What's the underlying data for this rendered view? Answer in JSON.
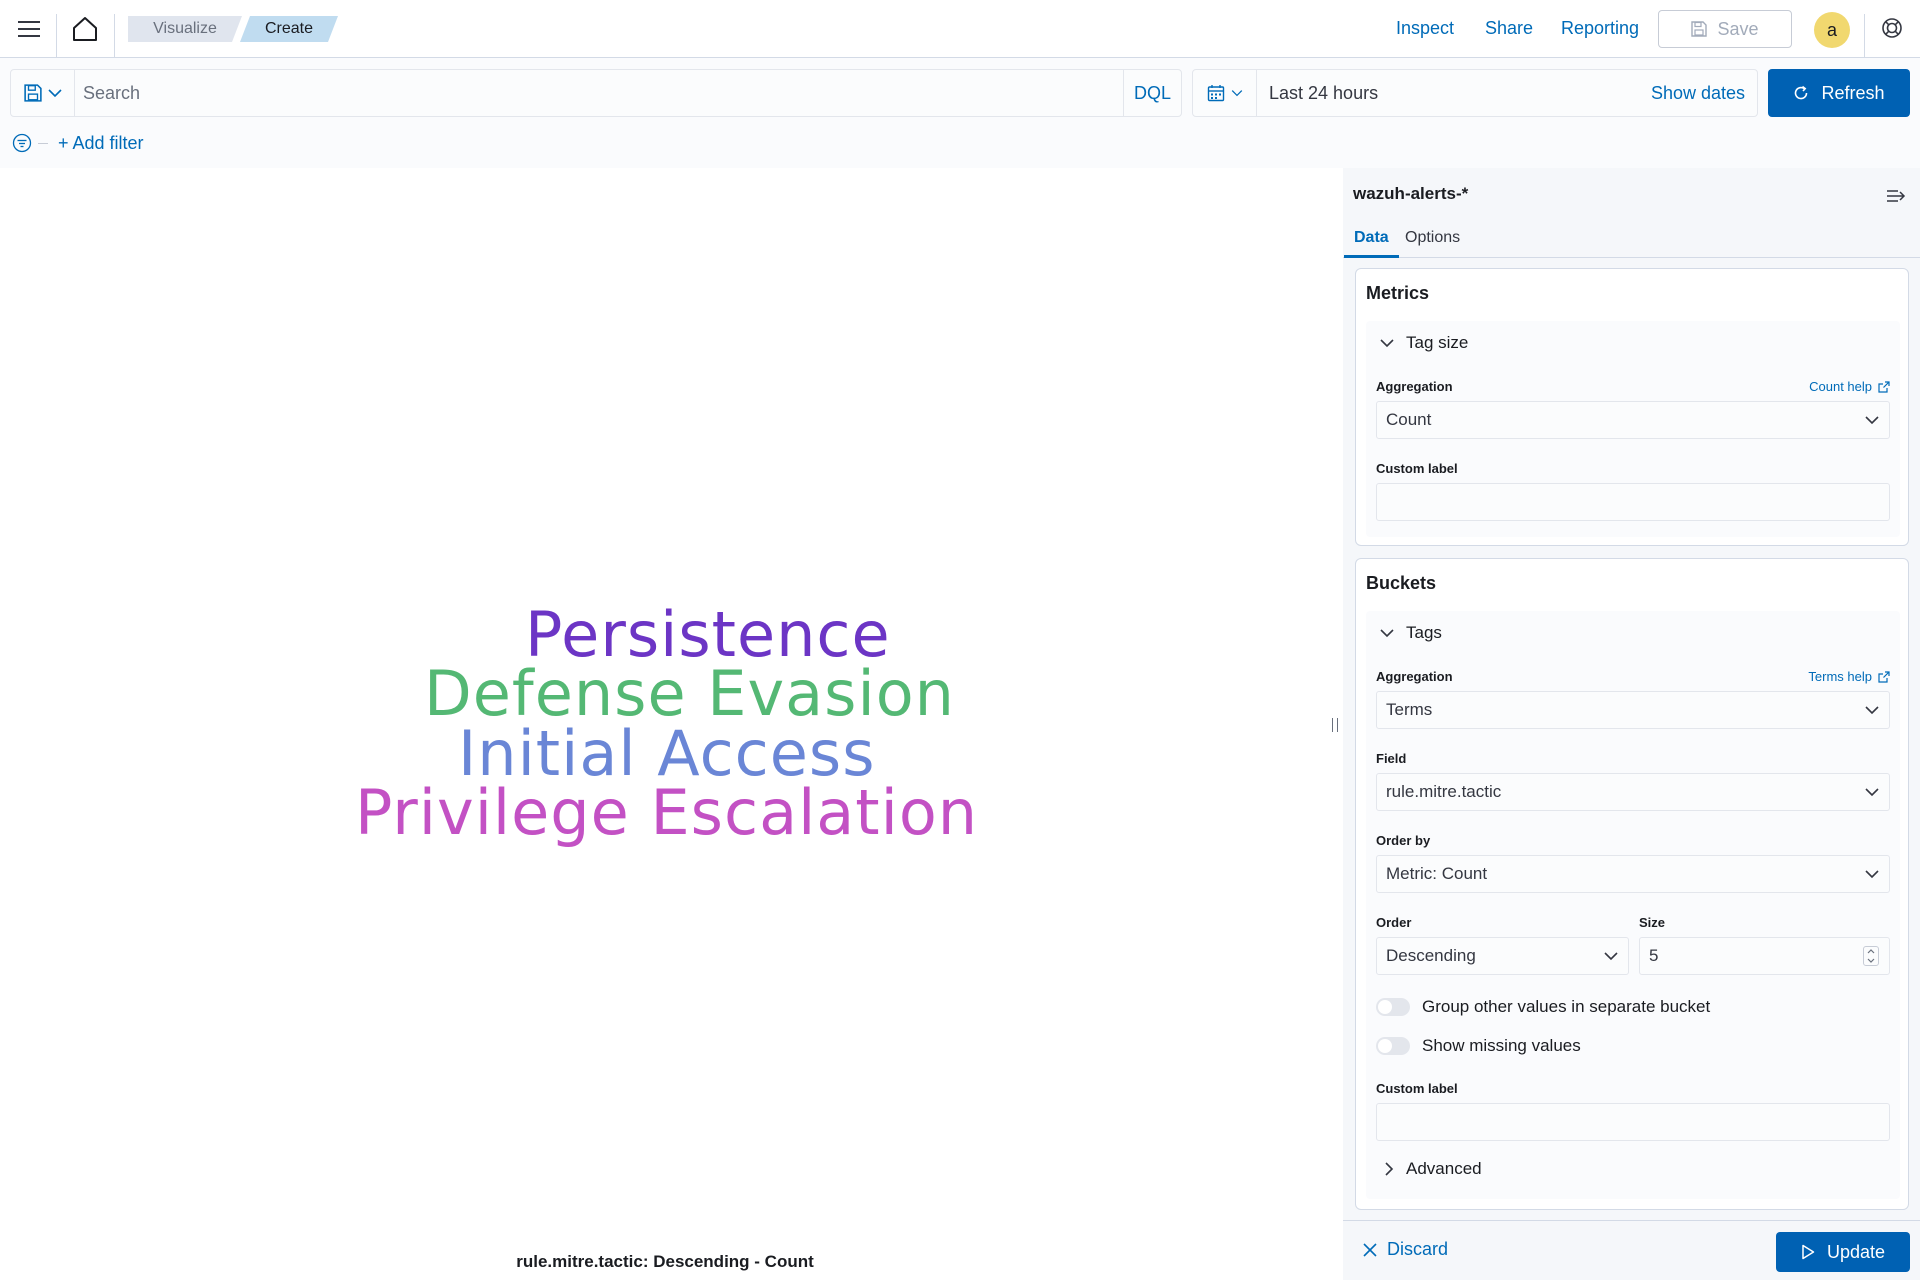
{
  "header": {
    "breadcrumbs": [
      "Visualize",
      "Create"
    ],
    "links": [
      "Inspect",
      "Share",
      "Reporting"
    ],
    "save_label": "Save",
    "avatar_initial": "a"
  },
  "query_bar": {
    "search_placeholder": "Search",
    "language": "DQL",
    "time_range": "Last 24 hours",
    "show_dates": "Show dates",
    "refresh_label": "Refresh",
    "add_filter": "+ Add filter"
  },
  "visualization": {
    "words": [
      {
        "text": "Persistence",
        "color": "#6c35c5"
      },
      {
        "text": "Defense Evasion",
        "color": "#54b874"
      },
      {
        "text": "Initial Access",
        "color": "#6a86d6"
      },
      {
        "text": "Privilege Escalation",
        "color": "#c351c4"
      }
    ],
    "caption": "rule.mitre.tactic: Descending - Count"
  },
  "sidebar": {
    "index_pattern": "wazuh-alerts-*",
    "tabs": [
      "Data",
      "Options"
    ],
    "metrics": {
      "title": "Metrics",
      "agg_title": "Tag size",
      "aggregation_label": "Aggregation",
      "help_link": "Count help",
      "aggregation_value": "Count",
      "custom_label": "Custom label"
    },
    "buckets": {
      "title": "Buckets",
      "agg_title": "Tags",
      "aggregation_label": "Aggregation",
      "help_link": "Terms help",
      "aggregation_value": "Terms",
      "field_label": "Field",
      "field_value": "rule.mitre.tactic",
      "order_by_label": "Order by",
      "order_by_value": "Metric: Count",
      "order_label": "Order",
      "order_value": "Descending",
      "size_label": "Size",
      "size_value": "5",
      "toggle_other": "Group other values in separate bucket",
      "toggle_missing": "Show missing values",
      "custom_label": "Custom label",
      "advanced": "Advanced"
    },
    "discard_label": "Discard",
    "update_label": "Update"
  },
  "colors": {
    "primary": "#0061b3",
    "link": "#006bb8"
  }
}
